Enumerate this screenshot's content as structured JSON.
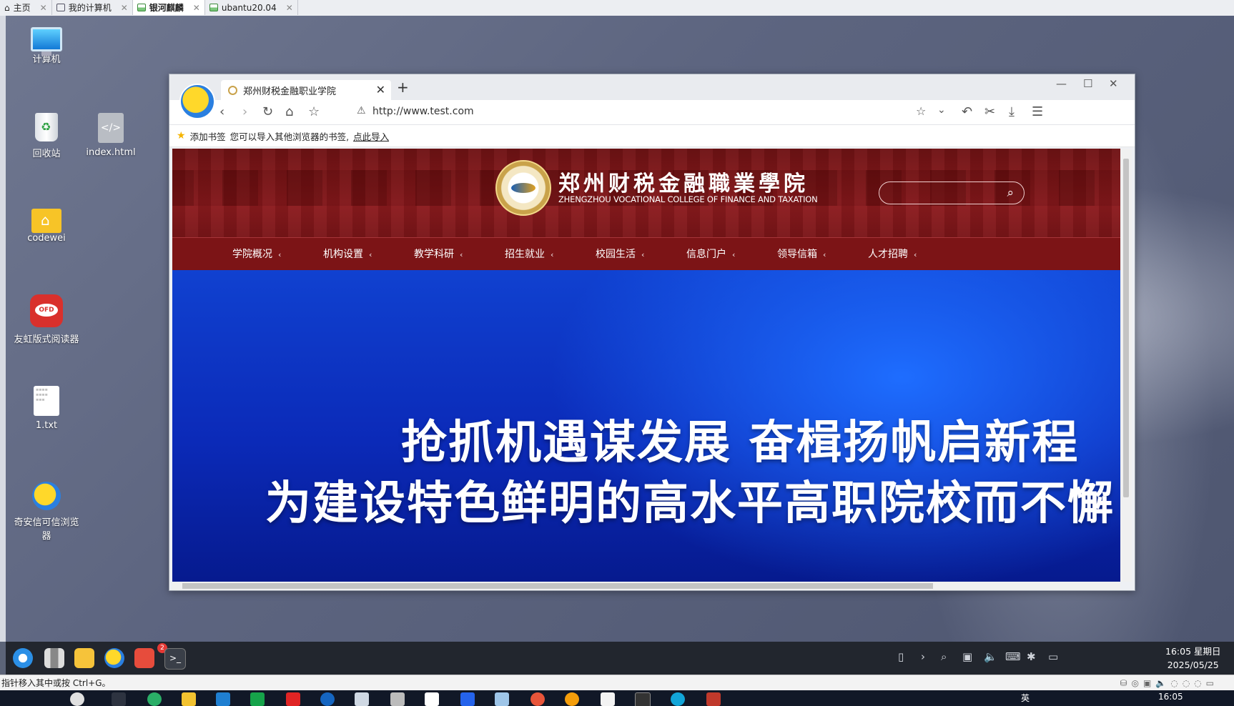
{
  "vm_tabs": [
    {
      "label": "主页",
      "active": false
    },
    {
      "label": "我的计算机",
      "active": false
    },
    {
      "label": "银河麒麟",
      "active": true
    },
    {
      "label": "ubantu20.04",
      "active": false
    }
  ],
  "desktop_icons": [
    {
      "label": "计算机",
      "icon": "computer-icon"
    },
    {
      "label": "回收站",
      "icon": "recycle-bin-icon"
    },
    {
      "label": "index.html",
      "icon": "code-file-icon"
    },
    {
      "label": "codewei",
      "icon": "home-folder-icon"
    },
    {
      "label": "友虹版式阅读器",
      "icon": "ofd-reader-icon"
    },
    {
      "label": "1.txt",
      "icon": "text-file-icon"
    },
    {
      "label": "奇安信可信浏览器",
      "icon": "qianxin-browser-icon"
    }
  ],
  "browser": {
    "tab_title": "郑州财税金融职业学院",
    "url": "http://www.test.com",
    "bookmarks_bar": {
      "add_label": "添加书签",
      "hint": "您可以导入其他浏览器的书签,",
      "import_link": "点此导入"
    }
  },
  "site": {
    "title_cn": "郑州财税金融職業學院",
    "title_en": "ZHENGZHOU VOCATIONAL COLLEGE OF FINANCE AND TAXATION",
    "search_placeholder": "",
    "nav": [
      "学院概况",
      "机构设置",
      "教学科研",
      "招生就业",
      "校园生活",
      "信息门户",
      "领导信箱",
      "人才招聘"
    ],
    "banner_line1": "抢抓机遇谋发展  奋楫扬帆启新程",
    "banner_line2": "为建设特色鲜明的高水平高职院校而不懈"
  },
  "guest_taskbar": {
    "time": "16:05 星期日",
    "date": "2025/05/25",
    "notification_badge": "2"
  },
  "host": {
    "status_text": "指针移入其中或按 Ctrl+G。",
    "time": "16:05",
    "ime": "英"
  },
  "colors": {
    "site_header": "#8e1b1e",
    "site_nav": "#7c1416",
    "banner_blue": "#0b2ab8",
    "guest_taskbar": "#22262e"
  }
}
